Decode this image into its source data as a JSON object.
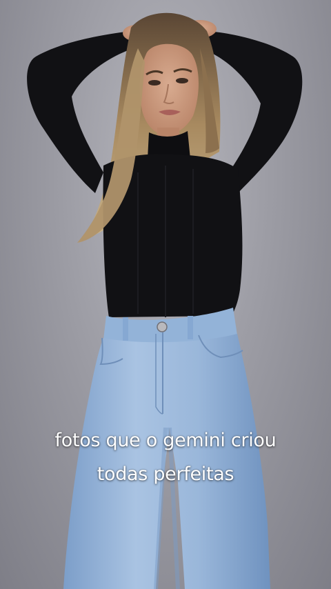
{
  "caption": {
    "line1": "fotos que o gemini criou",
    "line2": "todas perfeitas"
  },
  "colors": {
    "background": "#9c9ca4",
    "sweater": "#111114",
    "jeans": "#8fb0d6",
    "hair": "#a88a60",
    "skin": "#c99a80",
    "caption_text": "#ffffff"
  },
  "photo": {
    "subject": "woman-portrait"
  }
}
